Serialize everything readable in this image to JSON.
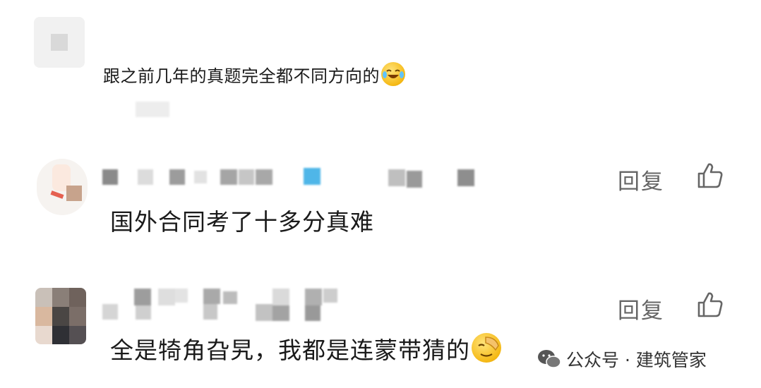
{
  "comments": [
    {
      "text": "跟之前几年的真题完全都不同方向的"
    },
    {
      "text": "国外合同考了十多分真难",
      "reply_label": "回复"
    },
    {
      "text": "全是犄角旮旯，我都是连蒙带猜的",
      "reply_label": "回复"
    }
  ],
  "watermark": {
    "text": "公众号 · 建筑管家"
  },
  "icons": [
    "thumbs-up-icon",
    "laughing-emoji-icon",
    "facepalm-emoji-icon",
    "wechat-icon"
  ],
  "colors": {
    "text": "#1a1a1a",
    "reply": "#666666",
    "pixelated_accent": "#4fb6e8"
  }
}
